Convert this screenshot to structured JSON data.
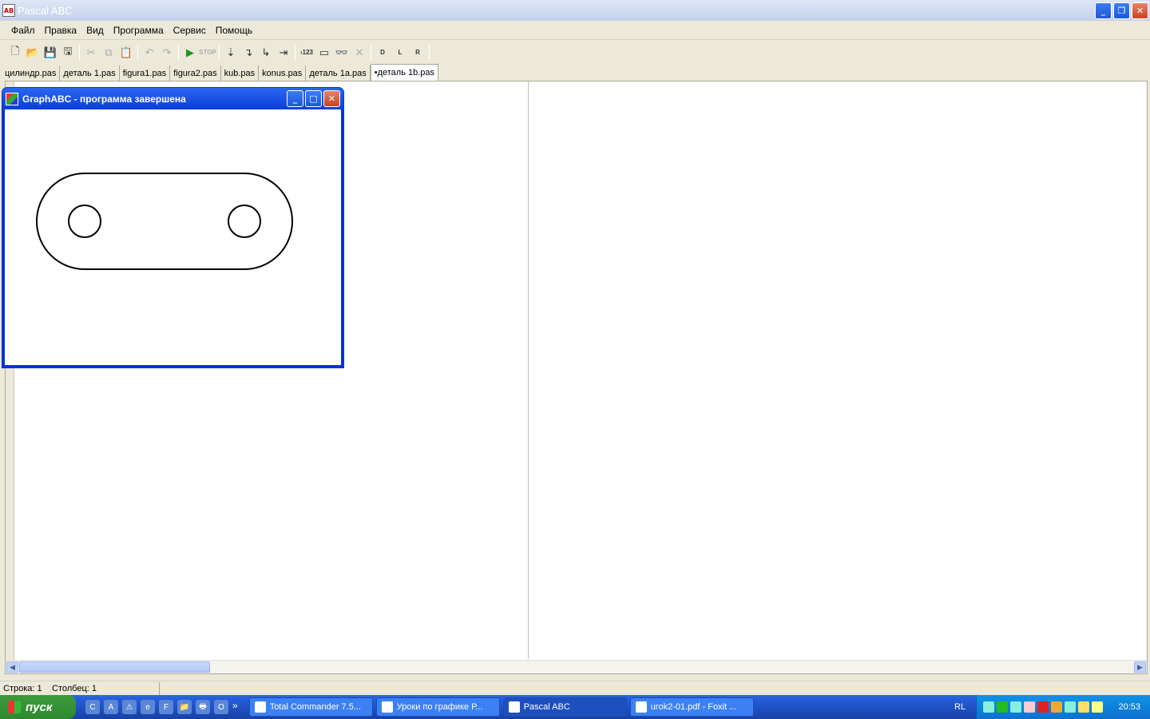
{
  "window": {
    "title": "Pascal ABC"
  },
  "menu": [
    "Файл",
    "Правка",
    "Вид",
    "Программа",
    "Сервис",
    "Помощь"
  ],
  "toolbar": [
    {
      "icon": "new-file-icon",
      "glyph": "🗋"
    },
    {
      "icon": "open-folder-icon",
      "glyph": "📂"
    },
    {
      "icon": "save-icon",
      "glyph": "💾",
      "disabled": true
    },
    {
      "icon": "save-all-icon",
      "glyph": "🖫"
    },
    {
      "icon": "cut-icon",
      "glyph": "✂",
      "disabled": true
    },
    {
      "icon": "copy-icon",
      "glyph": "⧉",
      "disabled": true
    },
    {
      "icon": "paste-icon",
      "glyph": "📋"
    },
    {
      "icon": "undo-icon",
      "glyph": "↶",
      "disabled": true
    },
    {
      "icon": "redo-icon",
      "glyph": "↷",
      "disabled": true
    },
    {
      "icon": "run-icon",
      "glyph": "▶"
    },
    {
      "icon": "stop-icon",
      "glyph": "STOP",
      "disabled": true
    },
    {
      "icon": "step-into-icon",
      "glyph": "⇣"
    },
    {
      "icon": "step-over-icon",
      "glyph": "↴"
    },
    {
      "icon": "step-out-icon",
      "glyph": "↳"
    },
    {
      "icon": "run-to-cursor-icon",
      "glyph": "⇥"
    },
    {
      "icon": "eval-icon",
      "glyph": "›123"
    },
    {
      "icon": "output-window-icon",
      "glyph": "▭"
    },
    {
      "icon": "watch-icon",
      "glyph": "👓"
    },
    {
      "icon": "close-icon",
      "glyph": "✕",
      "disabled": true
    },
    {
      "icon": "doc-d-icon",
      "glyph": "D"
    },
    {
      "icon": "doc-l-icon",
      "glyph": "L"
    },
    {
      "icon": "doc-r-icon",
      "glyph": "R"
    }
  ],
  "tabs": [
    {
      "label": "цилиндр.pas"
    },
    {
      "label": "деталь 1.pas"
    },
    {
      "label": "figura1.pas"
    },
    {
      "label": "figura2.pas"
    },
    {
      "label": "kub.pas"
    },
    {
      "label": "konus.pas"
    },
    {
      "label": "деталь 1a.pas"
    },
    {
      "label": "•деталь 1b.pas",
      "active": true
    }
  ],
  "graph_window": {
    "title": "GraphABC - программа завершена"
  },
  "status": {
    "line": "Строка: 1",
    "column": "Столбец: 1"
  },
  "taskbar": {
    "start": "пуск",
    "quick_launch": [
      "C",
      "A",
      "⚠",
      "e",
      "F",
      "📁",
      "🖶",
      "O"
    ],
    "chevron": "»",
    "tasks": [
      {
        "label": "Total Commander 7.5...",
        "active": false
      },
      {
        "label": "Уроки по графике Р...",
        "active": false
      },
      {
        "label": "Pascal ABC",
        "active": true
      },
      {
        "label": "urok2-01.pdf - Foxit ...",
        "active": false
      }
    ],
    "language": "RL",
    "clock": "20:53"
  }
}
